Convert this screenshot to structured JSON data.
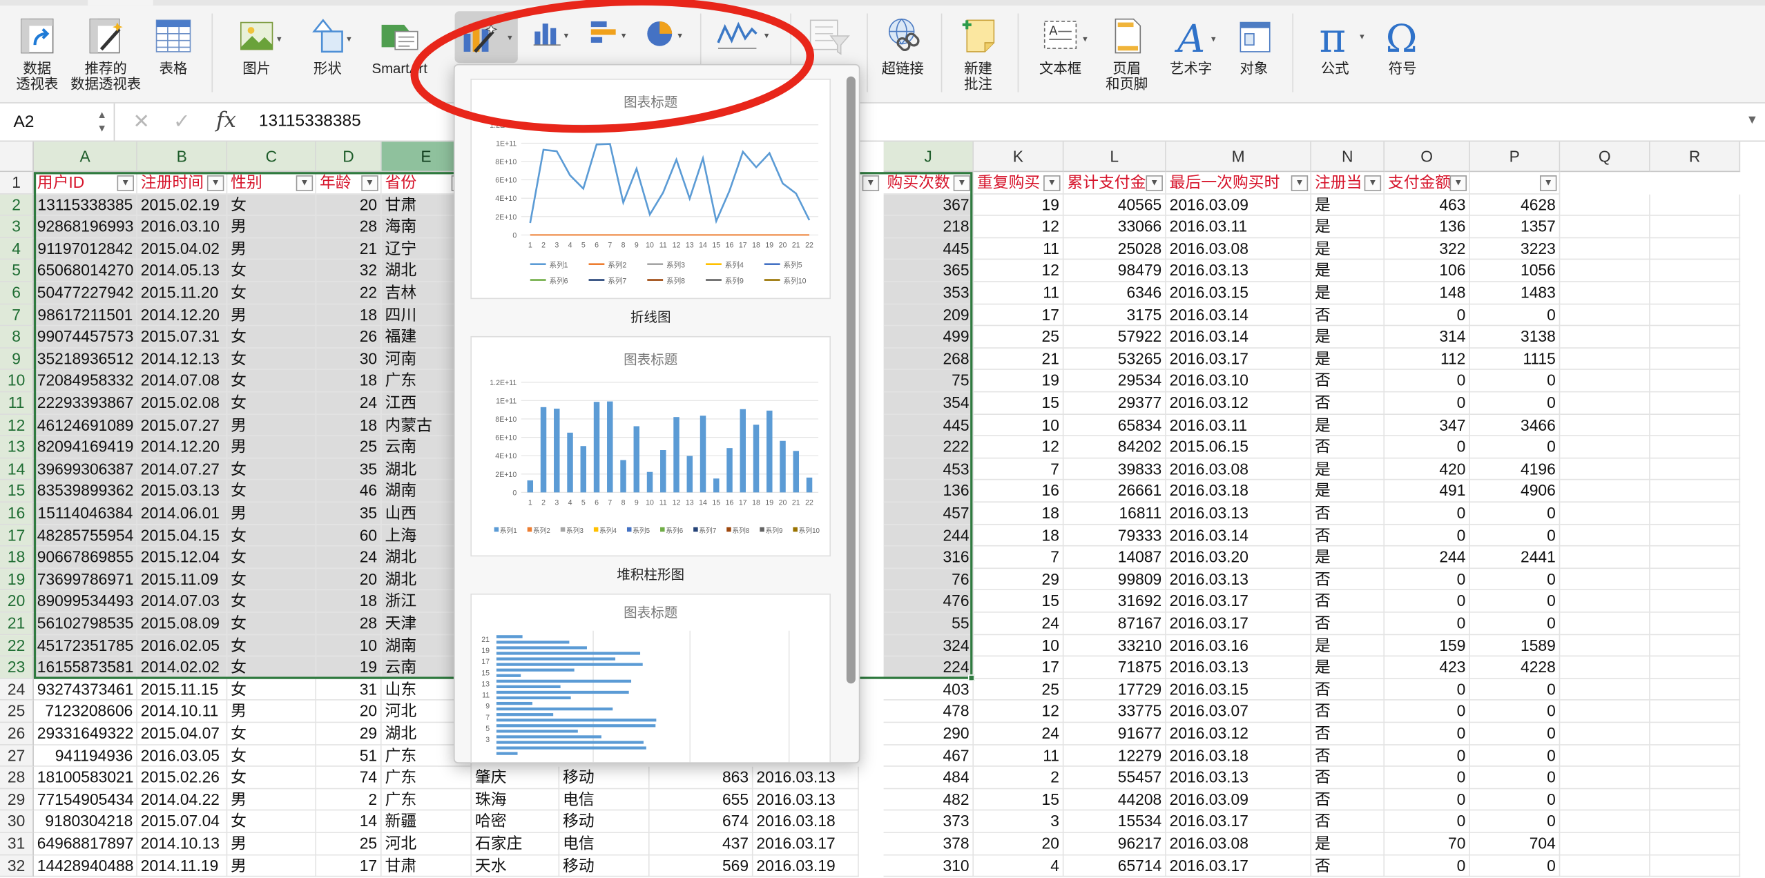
{
  "ribbon": {
    "buttons": [
      {
        "id": "pivot",
        "label": "数据\n透视表",
        "icon": "pivot-table-icon"
      },
      {
        "id": "rec_pivot",
        "label": "推荐的\n数据透视表",
        "icon": "recommended-pivot-icon"
      },
      {
        "id": "table",
        "label": "表格",
        "icon": "table-icon"
      },
      {
        "id": "picture",
        "label": "图片",
        "icon": "picture-icon"
      },
      {
        "id": "shape",
        "label": "形状",
        "icon": "shape-icon"
      },
      {
        "id": "smartart",
        "label": "SmartArt",
        "icon": "smartart-icon"
      },
      {
        "id": "hyperlink",
        "label": "超链接",
        "icon": "hyperlink-icon"
      },
      {
        "id": "comment",
        "label": "新建\n批注",
        "icon": "new-comment-icon"
      },
      {
        "id": "textbox",
        "label": "文本框",
        "icon": "textbox-icon"
      },
      {
        "id": "headerfooter",
        "label": "页眉\n和页脚",
        "icon": "header-footer-icon"
      },
      {
        "id": "wordart",
        "label": "艺术字",
        "icon": "wordart-icon"
      },
      {
        "id": "object",
        "label": "对象",
        "icon": "object-icon"
      },
      {
        "id": "equation",
        "label": "公式",
        "icon": "equation-icon"
      },
      {
        "id": "symbol",
        "label": "符号",
        "icon": "symbol-icon"
      }
    ]
  },
  "formula_bar": {
    "name_box": "A2",
    "fx": "fx",
    "value": "13115338385"
  },
  "columns": [
    "A",
    "B",
    "C",
    "D",
    "E",
    "J",
    "K",
    "L",
    "M",
    "N",
    "O",
    "P",
    "Q",
    "R"
  ],
  "headers": {
    "A": "用户ID",
    "B": "注册时间",
    "C": "性别",
    "D": "年龄",
    "E": "省份",
    "J": "购买次数",
    "K": "重复购买",
    "L": "累计支付金",
    "M": "最后一次购买时",
    "N": "注册当",
    "O": "支付金额",
    "P": ""
  },
  "rows": [
    {
      "n": "2",
      "A": "13115338385",
      "B": "2015.02.19",
      "C": "女",
      "D": "20",
      "E": "甘肃",
      "J": "367",
      "K": "19",
      "L": "40565",
      "M": "2016.03.09",
      "N": "是",
      "O": "463",
      "P": "4628"
    },
    {
      "n": "3",
      "A": "92868196993",
      "B": "2016.03.10",
      "C": "男",
      "D": "28",
      "E": "海南",
      "J": "218",
      "K": "12",
      "L": "33066",
      "M": "2016.03.11",
      "N": "是",
      "O": "136",
      "P": "1357"
    },
    {
      "n": "4",
      "A": "91197012842",
      "B": "2015.04.02",
      "C": "男",
      "D": "21",
      "E": "辽宁",
      "J": "445",
      "K": "11",
      "L": "25028",
      "M": "2016.03.08",
      "N": "是",
      "O": "322",
      "P": "3223"
    },
    {
      "n": "5",
      "A": "65068014270",
      "B": "2014.05.13",
      "C": "女",
      "D": "32",
      "E": "湖北",
      "J": "365",
      "K": "12",
      "L": "98479",
      "M": "2016.03.13",
      "N": "是",
      "O": "106",
      "P": "1056"
    },
    {
      "n": "6",
      "A": "50477227942",
      "B": "2015.11.20",
      "C": "女",
      "D": "22",
      "E": "吉林",
      "J": "353",
      "K": "11",
      "L": "6346",
      "M": "2016.03.15",
      "N": "是",
      "O": "148",
      "P": "1483"
    },
    {
      "n": "7",
      "A": "98617211501",
      "B": "2014.12.20",
      "C": "男",
      "D": "18",
      "E": "四川",
      "J": "209",
      "K": "17",
      "L": "3175",
      "M": "2016.03.14",
      "N": "否",
      "O": "0",
      "P": "0"
    },
    {
      "n": "8",
      "A": "99074457573",
      "B": "2015.07.31",
      "C": "女",
      "D": "26",
      "E": "福建",
      "J": "499",
      "K": "25",
      "L": "57922",
      "M": "2016.03.14",
      "N": "是",
      "O": "314",
      "P": "3138"
    },
    {
      "n": "9",
      "A": "35218936512",
      "B": "2014.12.13",
      "C": "女",
      "D": "30",
      "E": "河南",
      "J": "268",
      "K": "21",
      "L": "53265",
      "M": "2016.03.17",
      "N": "是",
      "O": "112",
      "P": "1115"
    },
    {
      "n": "10",
      "A": "72084958332",
      "B": "2014.07.08",
      "C": "女",
      "D": "18",
      "E": "广东",
      "J": "75",
      "K": "19",
      "L": "29534",
      "M": "2016.03.10",
      "N": "否",
      "O": "0",
      "P": "0"
    },
    {
      "n": "11",
      "A": "22293393867",
      "B": "2015.02.08",
      "C": "女",
      "D": "24",
      "E": "江西",
      "J": "354",
      "K": "15",
      "L": "29377",
      "M": "2016.03.12",
      "N": "否",
      "O": "0",
      "P": "0"
    },
    {
      "n": "12",
      "A": "46124691089",
      "B": "2015.07.27",
      "C": "男",
      "D": "18",
      "E": "内蒙古",
      "J": "445",
      "K": "10",
      "L": "65834",
      "M": "2016.03.11",
      "N": "是",
      "O": "347",
      "P": "3466"
    },
    {
      "n": "13",
      "A": "82094169419",
      "B": "2014.12.20",
      "C": "男",
      "D": "25",
      "E": "云南",
      "J": "222",
      "K": "12",
      "L": "84202",
      "M": "2015.06.15",
      "N": "否",
      "O": "0",
      "P": "0"
    },
    {
      "n": "14",
      "A": "39699306387",
      "B": "2014.07.27",
      "C": "女",
      "D": "35",
      "E": "湖北",
      "J": "453",
      "K": "7",
      "L": "39833",
      "M": "2016.03.08",
      "N": "是",
      "O": "420",
      "P": "4196"
    },
    {
      "n": "15",
      "A": "83539899362",
      "B": "2015.03.13",
      "C": "女",
      "D": "46",
      "E": "湖南",
      "J": "136",
      "K": "16",
      "L": "26661",
      "M": "2016.03.18",
      "N": "是",
      "O": "491",
      "P": "4906"
    },
    {
      "n": "16",
      "A": "15114046384",
      "B": "2014.06.01",
      "C": "男",
      "D": "35",
      "E": "山西",
      "J": "457",
      "K": "18",
      "L": "16811",
      "M": "2016.03.13",
      "N": "否",
      "O": "0",
      "P": "0"
    },
    {
      "n": "17",
      "A": "48285755954",
      "B": "2015.04.15",
      "C": "女",
      "D": "60",
      "E": "上海",
      "J": "244",
      "K": "18",
      "L": "79333",
      "M": "2016.03.14",
      "N": "否",
      "O": "0",
      "P": "0"
    },
    {
      "n": "18",
      "A": "90667869855",
      "B": "2015.12.04",
      "C": "女",
      "D": "24",
      "E": "湖北",
      "J": "316",
      "K": "7",
      "L": "14087",
      "M": "2016.03.20",
      "N": "是",
      "O": "244",
      "P": "2441"
    },
    {
      "n": "19",
      "A": "73699786971",
      "B": "2015.11.09",
      "C": "女",
      "D": "20",
      "E": "湖北",
      "J": "76",
      "K": "29",
      "L": "99809",
      "M": "2016.03.13",
      "N": "否",
      "O": "0",
      "P": "0"
    },
    {
      "n": "20",
      "A": "89099534493",
      "B": "2014.07.03",
      "C": "女",
      "D": "18",
      "E": "浙江",
      "J": "476",
      "K": "15",
      "L": "31692",
      "M": "2016.03.17",
      "N": "否",
      "O": "0",
      "P": "0"
    },
    {
      "n": "21",
      "A": "56102798535",
      "B": "2015.08.09",
      "C": "女",
      "D": "28",
      "E": "天津",
      "J": "55",
      "K": "24",
      "L": "87167",
      "M": "2016.03.17",
      "N": "否",
      "O": "0",
      "P": "0"
    },
    {
      "n": "22",
      "A": "45172351785",
      "B": "2016.02.05",
      "C": "女",
      "D": "10",
      "E": "湖南",
      "J": "324",
      "K": "10",
      "L": "33210",
      "M": "2016.03.16",
      "N": "是",
      "O": "159",
      "P": "1589"
    },
    {
      "n": "23",
      "A": "16155873581",
      "B": "2014.02.02",
      "C": "女",
      "D": "19",
      "E": "云南",
      "J": "224",
      "K": "17",
      "L": "71875",
      "M": "2016.03.13",
      "N": "是",
      "O": "423",
      "P": "4228"
    },
    {
      "n": "24",
      "A": "93274373461",
      "B": "2015.11.15",
      "C": "女",
      "D": "31",
      "E": "山东",
      "J": "403",
      "K": "25",
      "L": "17729",
      "M": "2016.03.15",
      "N": "否",
      "O": "0",
      "P": "0"
    },
    {
      "n": "25",
      "A": "7123208606",
      "B": "2014.10.11",
      "C": "男",
      "D": "20",
      "E": "河北",
      "J": "478",
      "K": "12",
      "L": "33775",
      "M": "2016.03.07",
      "N": "否",
      "O": "0",
      "P": "0"
    },
    {
      "n": "26",
      "A": "29331649322",
      "B": "2015.04.07",
      "C": "女",
      "D": "29",
      "E": "湖北",
      "J": "290",
      "K": "24",
      "L": "91677",
      "M": "2016.03.12",
      "N": "否",
      "O": "0",
      "P": "0"
    },
    {
      "n": "27",
      "A": "941194936",
      "B": "2016.03.05",
      "C": "女",
      "D": "51",
      "E": "广东",
      "J": "467",
      "K": "11",
      "L": "12279",
      "M": "2016.03.18",
      "N": "否",
      "O": "0",
      "P": "0"
    },
    {
      "n": "28",
      "A": "18100583021",
      "B": "2015.02.26",
      "C": "女",
      "D": "74",
      "E": "广东",
      "F": "肇庆",
      "G": "移动",
      "H": "863",
      "I": "2016.03.13",
      "J": "484",
      "K": "2",
      "L": "55457",
      "M": "2016.03.13",
      "N": "否",
      "O": "0",
      "P": "0"
    },
    {
      "n": "29",
      "A": "77154905434",
      "B": "2014.04.22",
      "C": "男",
      "D": "2",
      "E": "广东",
      "F": "珠海",
      "G": "电信",
      "H": "655",
      "I": "2016.03.13",
      "J": "482",
      "K": "15",
      "L": "44208",
      "M": "2016.03.09",
      "N": "否",
      "O": "0",
      "P": "0"
    },
    {
      "n": "30",
      "A": "9180304218",
      "B": "2015.07.04",
      "C": "女",
      "D": "14",
      "E": "新疆",
      "F": "哈密",
      "G": "移动",
      "H": "674",
      "I": "2016.03.18",
      "J": "373",
      "K": "3",
      "L": "15534",
      "M": "2016.03.17",
      "N": "否",
      "O": "0",
      "P": "0"
    },
    {
      "n": "31",
      "A": "64968817897",
      "B": "2014.10.13",
      "C": "男",
      "D": "25",
      "E": "河北",
      "F": "石家庄",
      "G": "电信",
      "H": "437",
      "I": "2016.03.17",
      "J": "378",
      "K": "20",
      "L": "96217",
      "M": "2016.03.08",
      "N": "是",
      "O": "70",
      "P": "704"
    },
    {
      "n": "32",
      "A": "14428940488",
      "B": "2014.11.19",
      "C": "男",
      "D": "17",
      "E": "甘肃",
      "F": "天水",
      "G": "移动",
      "H": "569",
      "I": "2016.03.19",
      "J": "310",
      "K": "4",
      "L": "65714",
      "M": "2016.03.17",
      "N": "否",
      "O": "0",
      "P": "0"
    }
  ],
  "gallery": {
    "thumbnails": [
      {
        "caption": "折线图",
        "chart_title": "图表标题",
        "y_ticks": [
          "1.2E+11",
          "1E+11",
          "8E+10",
          "6E+10",
          "4E+10",
          "2E+10",
          "0"
        ],
        "x_ticks": [
          "1",
          "2",
          "3",
          "4",
          "5",
          "6",
          "7",
          "8",
          "9",
          "10",
          "11",
          "12",
          "13",
          "14",
          "15",
          "16",
          "17",
          "18",
          "19",
          "20",
          "21",
          "22"
        ],
        "legend": [
          "系列1",
          "系列2",
          "系列3",
          "系列4",
          "系列5",
          "系列6",
          "系列7",
          "系列8",
          "系列9",
          "系列10"
        ]
      },
      {
        "caption": "堆积柱形图",
        "chart_title": "图表标题",
        "y_ticks": [
          "1.2E+11",
          "1E+11",
          "8E+10",
          "6E+10",
          "4E+10",
          "2E+10",
          "0"
        ],
        "x_ticks": [
          "1",
          "2",
          "3",
          "4",
          "5",
          "6",
          "7",
          "8",
          "9",
          "10",
          "11",
          "12",
          "13",
          "14",
          "15",
          "16",
          "17",
          "18",
          "19",
          "20",
          "21",
          "22"
        ],
        "legend": [
          "系列1",
          "系列2",
          "系列3",
          "系列4",
          "系列5",
          "系列6",
          "系列7",
          "系列8",
          "系列9",
          "系列10"
        ]
      },
      {
        "caption": "",
        "chart_title": "图表标题",
        "y_ticks": [
          "21",
          "19",
          "17",
          "15",
          "13",
          "11",
          "9",
          "7",
          "5",
          "3"
        ]
      }
    ],
    "series1_values": [
      13115338385,
      92868196993,
      91197012842,
      65068014270,
      50477227942,
      98617211501,
      99074457573,
      35218936512,
      72084958332,
      22293393867,
      46124691089,
      82094169419,
      39699306387,
      83539899362,
      15114046384,
      48285755954,
      90667869855,
      73699786971,
      89099534493,
      56102798535,
      45172351785,
      16155873581
    ],
    "series_colors": [
      "#5b9bd5",
      "#ed7d31",
      "#a5a5a5",
      "#ffc000",
      "#4472c4",
      "#70ad47",
      "#264478",
      "#9e480e",
      "#636363",
      "#997300"
    ]
  },
  "colors": {
    "accent_green": "#2f7a3f",
    "header_red": "#d6132a",
    "annotation_red": "#e8261a"
  }
}
